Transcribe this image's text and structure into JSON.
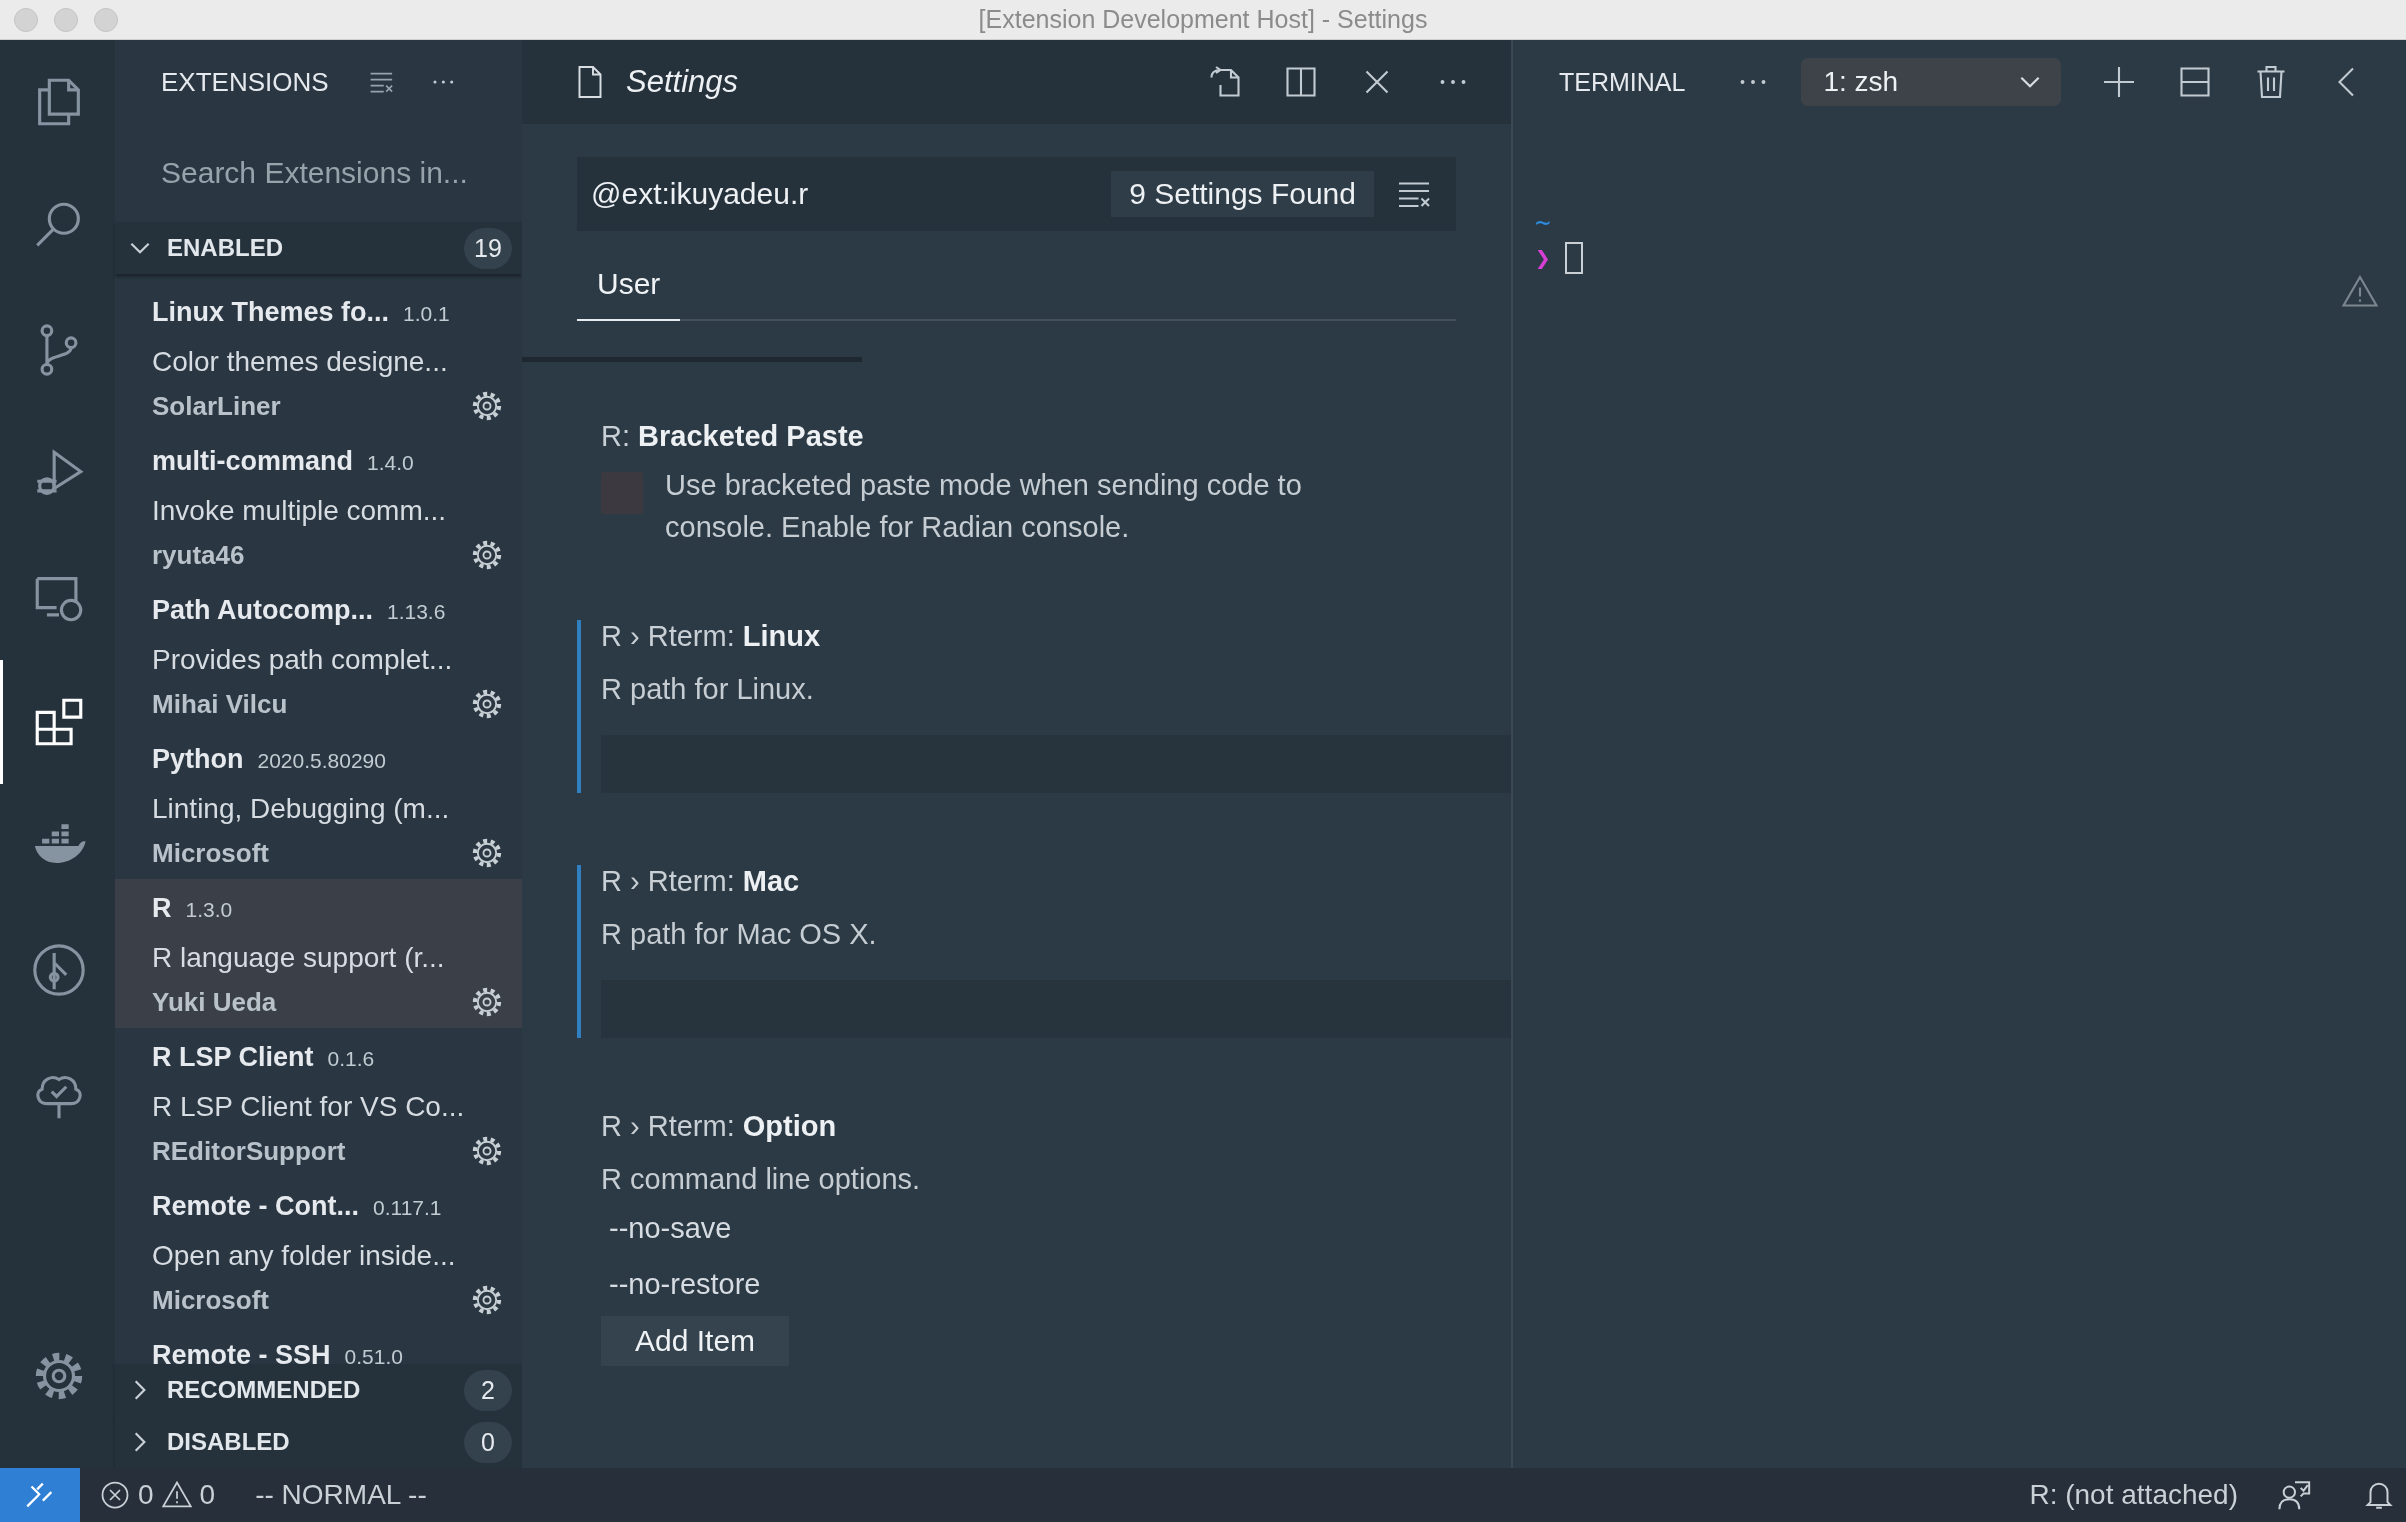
{
  "window": {
    "title": "[Extension Development Host] - Settings"
  },
  "activity_bar": {
    "items": [
      {
        "kind": "files",
        "selected": false
      },
      {
        "kind": "search",
        "selected": false
      },
      {
        "kind": "source-control",
        "selected": false
      },
      {
        "kind": "run",
        "selected": false
      },
      {
        "kind": "remote",
        "selected": false
      },
      {
        "kind": "extensions",
        "selected": true
      },
      {
        "kind": "docker",
        "selected": false
      },
      {
        "kind": "git-graph",
        "selected": false
      },
      {
        "kind": "tree",
        "selected": false
      }
    ],
    "bottom": [
      {
        "kind": "settings",
        "selected": false
      }
    ]
  },
  "sidebar": {
    "title": "EXTENSIONS",
    "search": {
      "placeholder": "Search Extensions in..."
    },
    "sections": [
      {
        "label": "ENABLED",
        "count": "19",
        "expanded": true,
        "items": [
          {
            "name": "Linux Themes fo...",
            "version": "1.0.1",
            "description": "Color themes designe...",
            "publisher": "SolarLiner",
            "selected": false
          },
          {
            "name": "multi-command",
            "version": "1.4.0",
            "description": "Invoke multiple comm...",
            "publisher": "ryuta46",
            "selected": false
          },
          {
            "name": "Path Autocomp...",
            "version": "1.13.6",
            "description": "Provides path complet...",
            "publisher": "Mihai Vilcu",
            "selected": false
          },
          {
            "name": "Python",
            "version": "2020.5.80290",
            "description": "Linting, Debugging (m...",
            "publisher": "Microsoft",
            "selected": false
          },
          {
            "name": "R",
            "version": "1.3.0",
            "description": "R language support (r...",
            "publisher": "Yuki Ueda",
            "selected": true
          },
          {
            "name": "R LSP Client",
            "version": "0.1.6",
            "description": "R LSP Client for VS Co...",
            "publisher": "REditorSupport",
            "selected": false
          },
          {
            "name": "Remote - Cont...",
            "version": "0.117.1",
            "description": "Open any folder inside...",
            "publisher": "Microsoft",
            "selected": false
          },
          {
            "name": "Remote - SSH",
            "version": "0.51.0",
            "selected": false
          }
        ]
      },
      {
        "label": "RECOMMENDED",
        "count": "2",
        "expanded": false
      },
      {
        "label": "DISABLED",
        "count": "0",
        "expanded": false
      }
    ]
  },
  "editor": {
    "tab": {
      "title": "Settings"
    },
    "search": {
      "value": "@ext:ikuyadeu.r",
      "result": "9 Settings Found"
    },
    "tabs": [
      {
        "label": "User",
        "selected": true
      }
    ],
    "settings": [
      {
        "kind": "checkbox",
        "category": "R: ",
        "name": "Bracketed Paste",
        "description": "Use bracketed paste mode when sending code to console. Enable for Radian console.",
        "checked": false,
        "modified": false
      },
      {
        "kind": "text",
        "category": "R › Rterm: ",
        "name": "Linux",
        "description": "R path for Linux.",
        "modified": true
      },
      {
        "kind": "text",
        "category": "R › Rterm: ",
        "name": "Mac",
        "description": "R path for Mac OS X.",
        "modified": true
      },
      {
        "kind": "list",
        "category": "R › Rterm: ",
        "name": "Option",
        "description": "R command line options.",
        "items": [
          "--no-save",
          "--no-restore"
        ],
        "button": "Add Item",
        "modified": false
      }
    ]
  },
  "panel": {
    "title": "TERMINAL",
    "terminal_select": {
      "value": "1: zsh"
    },
    "lines": [
      {
        "kind": "cwd",
        "text": "~"
      },
      {
        "kind": "prompt",
        "text": "❯"
      }
    ]
  },
  "status_bar": {
    "errors": "0",
    "warnings": "0",
    "mode": "-- NORMAL --",
    "r_status": "R: (not attached)"
  }
}
